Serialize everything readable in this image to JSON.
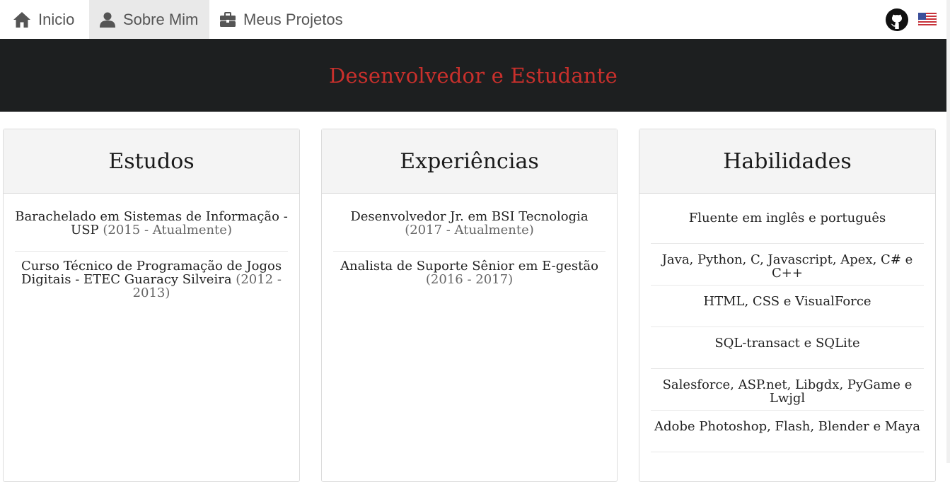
{
  "nav": {
    "items": [
      {
        "label": "Inicio",
        "icon": "home-icon"
      },
      {
        "label": "Sobre Mim",
        "icon": "user-icon"
      },
      {
        "label": "Meus Projetos",
        "icon": "briefcase-icon"
      }
    ],
    "active": "Sobre Mim",
    "right_icons": [
      "github-icon",
      "us-flag-icon"
    ]
  },
  "hero": {
    "title": "Desenvolvedor e Estudante",
    "title_color": "#c9302c",
    "background": "#1d1f20"
  },
  "cards": {
    "estudos": {
      "title": "Estudos",
      "entries": [
        {
          "text": "Barachelado em Sistemas de Informação - USP",
          "period": "(2015 - Atualmente)"
        },
        {
          "text": "Curso Técnico de Programação de Jogos Digitais - ETEC Guaracy Silveira",
          "period": "(2012 - 2013)"
        }
      ]
    },
    "experiencias": {
      "title": "Experiências",
      "entries": [
        {
          "text": "Desenvolvedor Jr. em BSI Tecnologia",
          "period": "(2017 - Atualmente)"
        },
        {
          "text": "Analista de Suporte Sênior em E-gestão",
          "period": "(2016 - 2017)"
        }
      ]
    },
    "habilidades": {
      "title": "Habilidades",
      "skills": [
        "Fluente em inglês e português",
        "Java, Python, C, Javascript, Apex, C# e C++",
        "HTML, CSS e VisualForce",
        "SQL-transact e SQLite",
        "Salesforce, ASP.net, Libgdx, PyGame e Lwjgl",
        "Adobe Photoshop, Flash, Blender e Maya"
      ]
    }
  }
}
